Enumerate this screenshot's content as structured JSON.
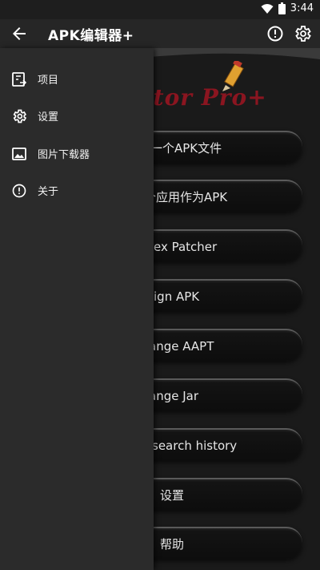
{
  "status": {
    "time": "3:44"
  },
  "appbar": {
    "title": "APK编辑器+"
  },
  "drawer": {
    "items": [
      {
        "label": "项目"
      },
      {
        "label": "设置"
      },
      {
        "label": "图片下载器"
      },
      {
        "label": "关于"
      }
    ]
  },
  "main": {
    "logo_text": "itor Pro+",
    "buttons": [
      {
        "label": "一个APK文件"
      },
      {
        "label": "个应用作为APK"
      },
      {
        "label": "ex Patcher"
      },
      {
        "label": "ign APK"
      },
      {
        "label": "ange AAPT"
      },
      {
        "label": "ange Jar"
      },
      {
        "label": "search history"
      },
      {
        "label": "设置"
      },
      {
        "label": "帮助"
      }
    ]
  },
  "colors": {
    "drawer_bg": "#2b2b2b",
    "logo": "#8b1520"
  }
}
